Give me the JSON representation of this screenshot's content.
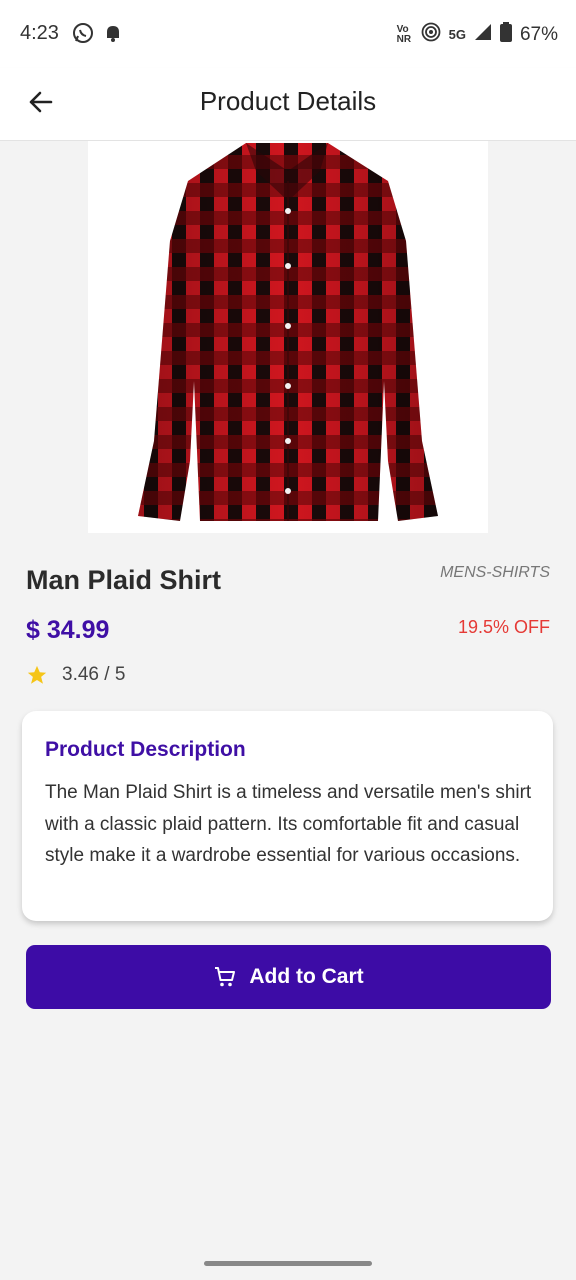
{
  "status_bar": {
    "time": "4:23",
    "network_label": "5G",
    "volte_label": "Vo NR",
    "battery": "67%"
  },
  "app_bar": {
    "title": "Product Details"
  },
  "product": {
    "name": "Man Plaid Shirt",
    "category": "MENS-SHIRTS",
    "price": "$ 34.99",
    "discount": "19.5% OFF",
    "rating": "3.46 / 5",
    "image_icon": "plaid-shirt-image"
  },
  "description": {
    "title": "Product Description",
    "body": "The Man Plaid Shirt is a timeless and versatile men's shirt with a classic plaid pattern. Its comfortable fit and casual style make it a wardrobe essential for various occasions."
  },
  "actions": {
    "add_to_cart": "Add to Cart"
  },
  "colors": {
    "accent": "#3d0ca6",
    "discount": "#e53935",
    "star": "#f5c518"
  }
}
